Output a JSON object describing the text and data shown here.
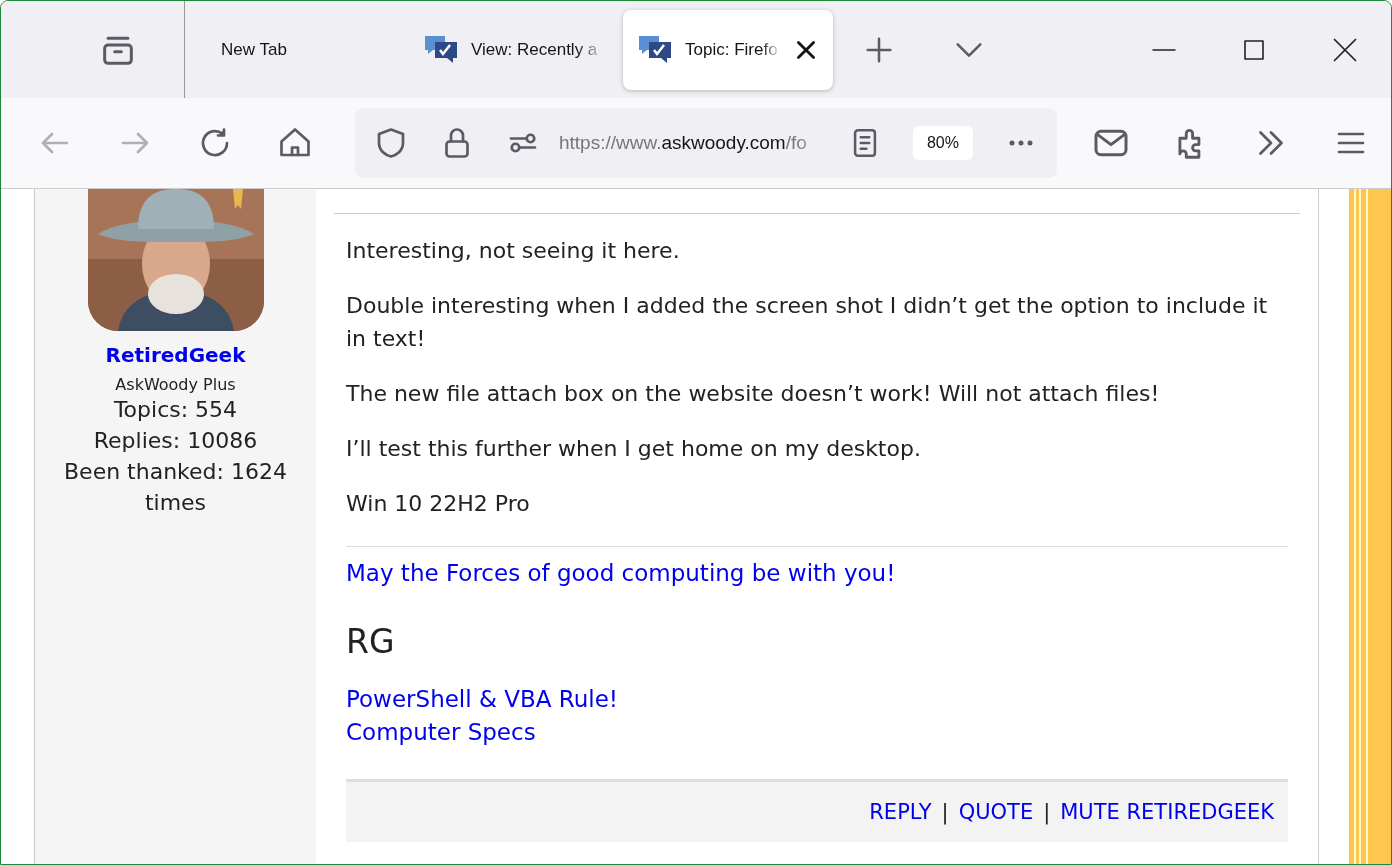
{
  "tabs": [
    {
      "label": "New Tab",
      "selected": false,
      "kind": "plain"
    },
    {
      "label": "View: Recently a",
      "selected": false,
      "kind": "site"
    },
    {
      "label": "Topic: Firefo",
      "selected": true,
      "kind": "site"
    }
  ],
  "toolbar": {
    "url_host_prefix": "https://www.",
    "url_host": "askwoody.com",
    "url_path": "/fo",
    "zoom": "80%"
  },
  "author": {
    "name": "RetiredGeek",
    "role": "AskWoody Plus",
    "stats": [
      "Topics: 554",
      "Replies: 10086",
      "Been thanked: 1624 times"
    ]
  },
  "post": {
    "paragraphs": [
      "Interesting, not seeing it here.",
      "Double interesting when I added the screen shot I didn’t get the option to include it in text!",
      "The new file attach box on the website doesn’t work! Will not attach files!",
      "I’ll test this further when I get home on my desktop.",
      "Win 10 22H2 Pro"
    ],
    "signature": {
      "motto": "May the Forces of good computing be with you!",
      "initials": "RG",
      "links": [
        "PowerShell & VBA Rule!",
        "Computer Specs"
      ]
    },
    "actions": [
      "REPLY",
      "QUOTE",
      "MUTE RETIREDGEEK"
    ],
    "action_separator": "|"
  }
}
